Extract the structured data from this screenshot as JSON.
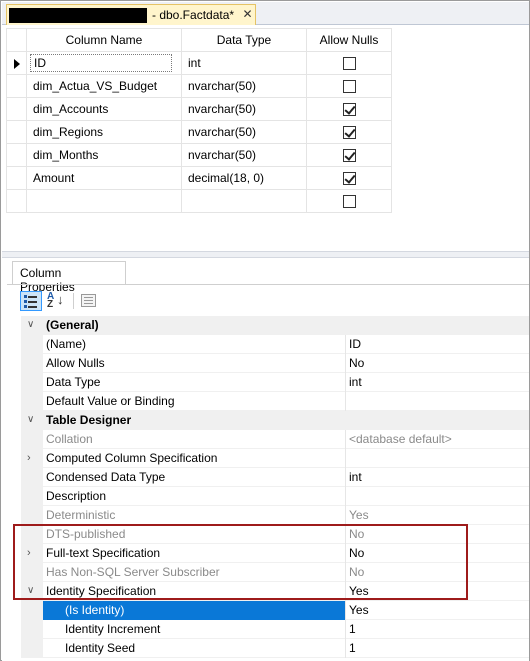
{
  "tab": {
    "title": "- dbo.Factdata*",
    "close": "✕"
  },
  "grid": {
    "headers": {
      "name": "Column Name",
      "type": "Data Type",
      "nulls": "Allow Nulls"
    },
    "rows": [
      {
        "name": "ID",
        "type": "int",
        "allow_nulls": false
      },
      {
        "name": "dim_Actua_VS_Budget",
        "type": "nvarchar(50)",
        "allow_nulls": false
      },
      {
        "name": "dim_Accounts",
        "type": "nvarchar(50)",
        "allow_nulls": true
      },
      {
        "name": "dim_Regions",
        "type": "nvarchar(50)",
        "allow_nulls": true
      },
      {
        "name": "dim_Months",
        "type": "nvarchar(50)",
        "allow_nulls": true
      },
      {
        "name": "Amount",
        "type": "decimal(18, 0)",
        "allow_nulls": true
      },
      {
        "name": "",
        "type": "",
        "allow_nulls": false
      }
    ]
  },
  "properties": {
    "tab_label": "Column Properties",
    "toolbar": {
      "categorized": "categorized-icon",
      "alphabetical": "sort-az-icon",
      "property_pages": "property-pages-icon"
    },
    "rows": [
      {
        "kind": "cat",
        "expander": "∨",
        "name": "(General)",
        "value": ""
      },
      {
        "kind": "item",
        "name": "(Name)",
        "value": "ID"
      },
      {
        "kind": "item",
        "name": "Allow Nulls",
        "value": "No"
      },
      {
        "kind": "item",
        "name": "Data Type",
        "value": "int"
      },
      {
        "kind": "item",
        "name": "Default Value or Binding",
        "value": ""
      },
      {
        "kind": "cat",
        "expander": "∨",
        "name": "Table Designer",
        "value": ""
      },
      {
        "kind": "dim",
        "name": "Collation",
        "value": "<database default>"
      },
      {
        "kind": "item",
        "expander": "›",
        "name": "Computed Column Specification",
        "value": ""
      },
      {
        "kind": "item",
        "name": "Condensed Data Type",
        "value": "int"
      },
      {
        "kind": "item",
        "name": "Description",
        "value": ""
      },
      {
        "kind": "dim",
        "name": "Deterministic",
        "value": "Yes"
      },
      {
        "kind": "dim",
        "name": "DTS-published",
        "value": "No"
      },
      {
        "kind": "item",
        "expander": "›",
        "name": "Full-text Specification",
        "value": "No"
      },
      {
        "kind": "dim",
        "name": "Has Non-SQL Server Subscriber",
        "value": "No"
      },
      {
        "kind": "item",
        "expander": "∨",
        "name": "Identity Specification",
        "value": "Yes"
      },
      {
        "kind": "sel",
        "name": "(Is Identity)",
        "value": "Yes"
      },
      {
        "kind": "sub",
        "name": "Identity Increment",
        "value": "1"
      },
      {
        "kind": "sub",
        "name": "Identity Seed",
        "value": "1"
      }
    ]
  },
  "colors": {
    "selection": "#0a78d7",
    "highlight_box": "#9e1b1b",
    "tab_active": "#fff5cc"
  }
}
